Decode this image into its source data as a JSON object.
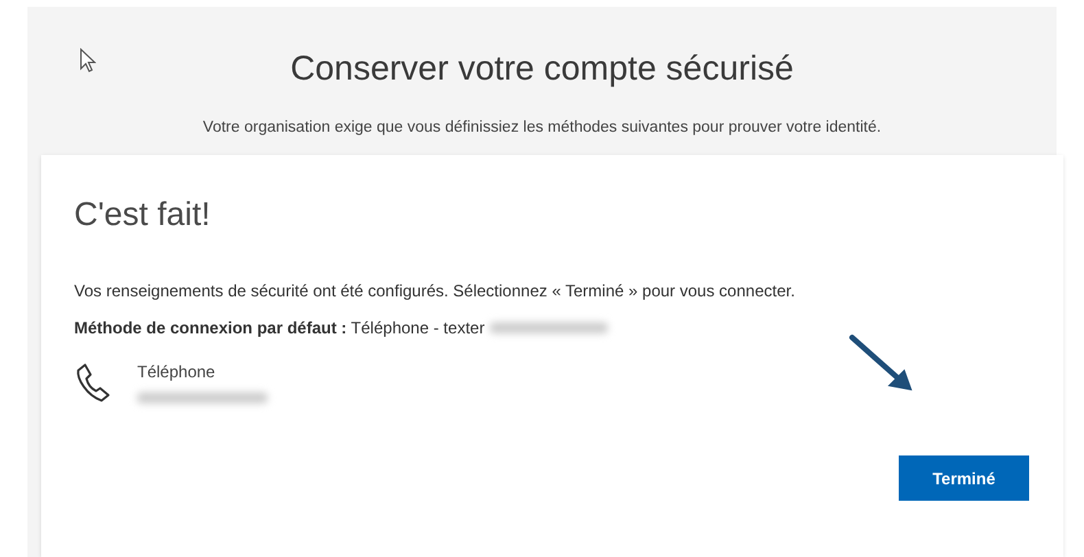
{
  "page": {
    "title": "Conserver votre compte sécurisé",
    "subtitle": "Votre organisation exige que vous définissiez les méthodes suivantes pour prouver votre identité."
  },
  "card": {
    "heading": "C'est fait!",
    "message": "Vos renseignements de sécurité ont été configurés. Sélectionnez « Terminé » pour vous connecter.",
    "default_method": "**Méthode de connexion par défaut :** Téléphone - texter",
    "methods": [
      {
        "kind": "phone",
        "name": "Téléphone"
      }
    ],
    "button": "Terminé"
  }
}
